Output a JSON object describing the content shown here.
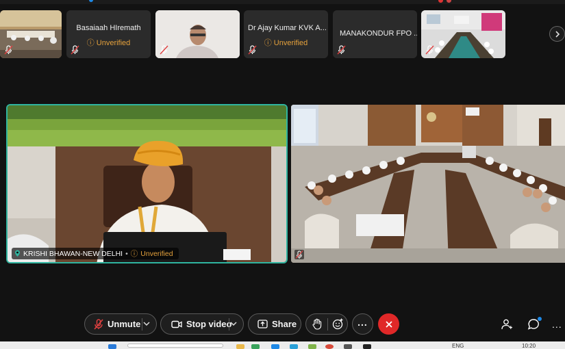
{
  "filmstrip": {
    "tiles": [
      {
        "name": "Basaiaah HIremath",
        "status": "Unverified"
      },
      {
        "name": "Dr Ajay Kumar KVK A...",
        "status": "Unverified"
      },
      {
        "name": "MANAKONDUR FPO ..."
      }
    ]
  },
  "main": {
    "left_video": {
      "name": "KRISHI BHAWAN-NEW DELHI",
      "separator": "•",
      "status": "Unverified"
    }
  },
  "controls": {
    "unmute_label": "Unmute",
    "stop_video_label": "Stop video",
    "share_label": "Share"
  },
  "taskbar": {
    "lang": "ENG",
    "time": "10:20"
  },
  "colors": {
    "accent_border": "#2fb5a0",
    "unverified": "#e6a23c",
    "end_call": "#e02828",
    "notification_dot": "#1e88e5"
  }
}
